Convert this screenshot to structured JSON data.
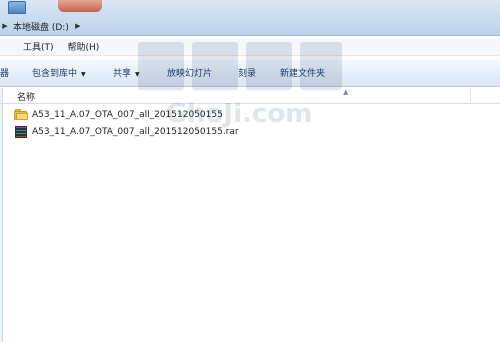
{
  "address": {
    "drive_label": "本地磁盘 (D:)"
  },
  "menu": {
    "tools": "工具(T)",
    "help": "帮助(H)"
  },
  "toolbar": {
    "partial": "器",
    "include_in_library": "包含到库中",
    "share": "共享",
    "slideshow": "放映幻灯片",
    "burn": "刻录",
    "new_folder": "新建文件夹"
  },
  "list": {
    "column_name": "名称",
    "rows": [
      {
        "name": "A53_11_A.07_OTA_007_all_201512050155",
        "icon": "folder-icon"
      },
      {
        "name": "A53_11_A.07_OTA_007_all_201512050155.rar",
        "icon": "rar-archive-icon"
      }
    ]
  },
  "watermark": {
    "text": "GhoJi.com",
    "color": "#1c3f6e"
  },
  "colors": {
    "toolbar_text": "#1e3a5f",
    "folder": "#e9c14b"
  }
}
